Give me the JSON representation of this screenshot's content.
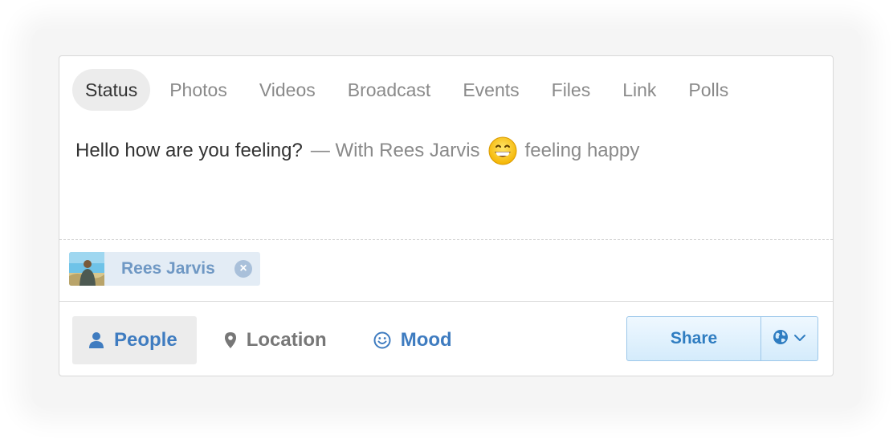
{
  "tabs": [
    {
      "label": "Status",
      "active": true
    },
    {
      "label": "Photos",
      "active": false
    },
    {
      "label": "Videos",
      "active": false
    },
    {
      "label": "Broadcast",
      "active": false
    },
    {
      "label": "Events",
      "active": false
    },
    {
      "label": "Files",
      "active": false
    },
    {
      "label": "Link",
      "active": false
    },
    {
      "label": "Polls",
      "active": false
    }
  ],
  "post": {
    "text": "Hello how are you feeling?",
    "with_prefix": "— With Rees Jarvis",
    "mood_text": "feeling happy",
    "mood_icon": "grinning-face-emoji"
  },
  "tagged": {
    "name": "Rees Jarvis",
    "remove_icon": "close-circle-icon"
  },
  "actions": {
    "people_label": "People",
    "location_label": "Location",
    "mood_label": "Mood"
  },
  "share": {
    "label": "Share",
    "privacy_icon": "globe-icon"
  },
  "colors": {
    "accent": "#3f7cc0",
    "share_border": "#9cc7ea",
    "tag_bg": "#e3ecf5"
  }
}
